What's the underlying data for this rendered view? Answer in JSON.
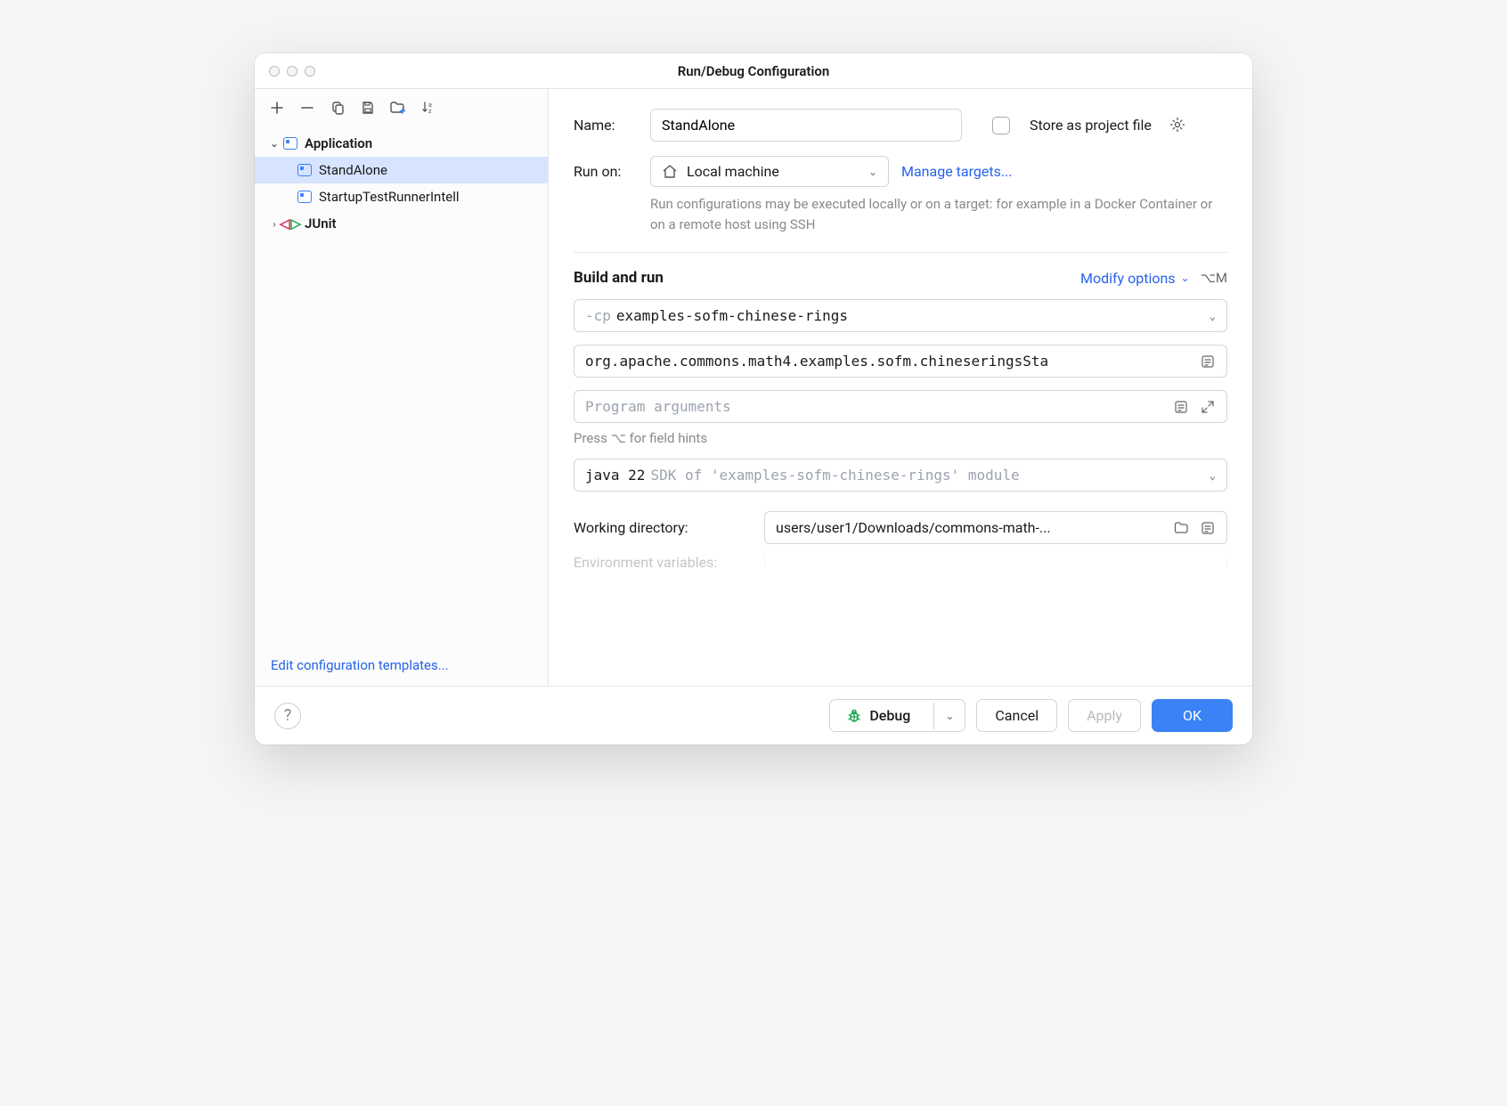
{
  "title": "Run/Debug Configuration",
  "sidebar": {
    "toolbar": {
      "add": "add",
      "remove": "remove",
      "copy": "copy",
      "save": "save",
      "folder": "new-folder",
      "sort": "sort"
    },
    "tree": [
      {
        "label": "Application",
        "expanded": true,
        "children": [
          {
            "label": "StandAlone",
            "selected": true
          },
          {
            "label": "StartupTestRunnerIntell"
          }
        ]
      },
      {
        "label": "JUnit",
        "icon": "junit",
        "expanded": false
      }
    ],
    "footer_link": "Edit configuration templates..."
  },
  "main": {
    "name_label": "Name:",
    "name_value": "StandAlone",
    "store_label": "Store as project file",
    "runon_label": "Run on:",
    "runon_value": "Local machine",
    "manage_targets": "Manage targets...",
    "runon_hint": "Run configurations may be executed locally or on a target: for example in a Docker Container or on a remote host using SSH",
    "section_title": "Build and run",
    "modify_options": "Modify options",
    "modify_shortcut": "⌥M",
    "cp_prefix": "-cp",
    "cp_value": "examples-sofm-chinese-rings",
    "main_class": "org.apache.commons.math4.examples.sofm.chineseringsSta",
    "program_args_placeholder": "Program arguments",
    "args_hint": "Press ⌥ for field hints",
    "jre_prefix": "java 22",
    "jre_suffix": "SDK of 'examples-sofm-chinese-rings' module",
    "working_dir_label": "Working directory:",
    "working_dir_value": "users/user1/Downloads/commons-math-...",
    "env_label_partial": "Environment variables:"
  },
  "footer": {
    "debug": "Debug",
    "cancel": "Cancel",
    "apply": "Apply",
    "ok": "OK"
  }
}
